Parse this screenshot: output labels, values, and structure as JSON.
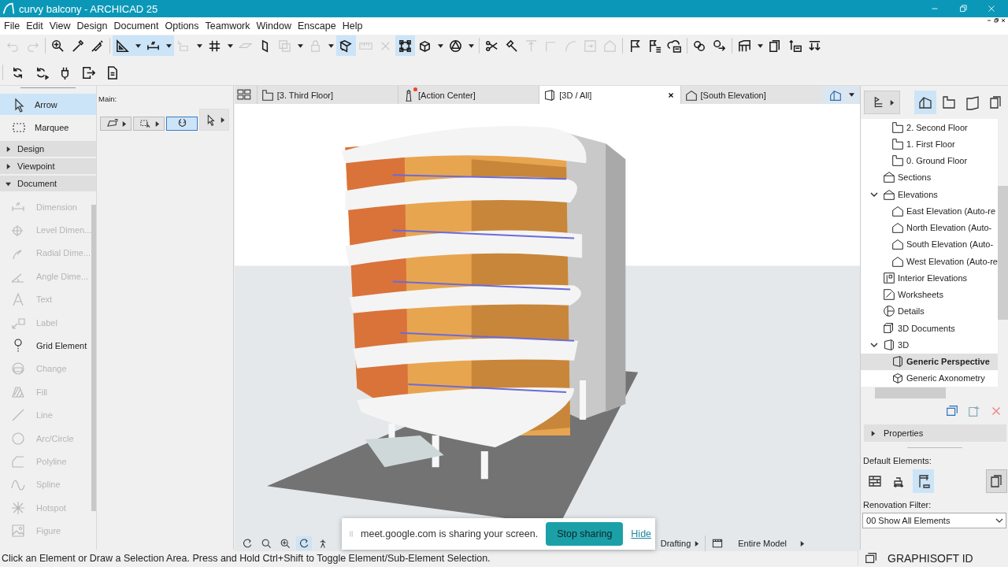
{
  "window": {
    "title": "curvy balcony - ARCHICAD 25"
  },
  "menu": [
    "File",
    "Edit",
    "View",
    "Design",
    "Document",
    "Options",
    "Teamwork",
    "Window",
    "Enscape",
    "Help"
  ],
  "toolbar": [
    {
      "kind": "undo",
      "on": false,
      "disabled": true
    },
    {
      "kind": "redo",
      "on": false,
      "disabled": true
    },
    {
      "kind": "sep"
    },
    {
      "kind": "find",
      "on": false,
      "disabled": false
    },
    {
      "kind": "eyedropper",
      "on": false,
      "disabled": false
    },
    {
      "kind": "syringe",
      "on": false,
      "disabled": false
    },
    {
      "kind": "sep"
    },
    {
      "kind": "setsquare",
      "on": true,
      "disabled": false
    },
    {
      "kind": "caret",
      "on": true
    },
    {
      "kind": "dimension",
      "on": true,
      "disabled": false
    },
    {
      "kind": "caret",
      "on": true
    },
    {
      "kind": "coordinate",
      "on": false,
      "disabled": true
    },
    {
      "kind": "caret",
      "on": false
    },
    {
      "kind": "grid",
      "on": false,
      "disabled": false
    },
    {
      "kind": "caret",
      "on": false
    },
    {
      "kind": "plane",
      "on": false,
      "disabled": true
    },
    {
      "kind": "vplane",
      "on": false,
      "disabled": false
    },
    {
      "kind": "layers",
      "on": false,
      "disabled": true
    },
    {
      "kind": "caret",
      "on": false
    },
    {
      "kind": "lock",
      "on": false,
      "disabled": true
    },
    {
      "kind": "caret",
      "on": false
    },
    {
      "kind": "selcube",
      "on": true,
      "disabled": false
    },
    {
      "kind": "ruler",
      "on": false,
      "disabled": true
    },
    {
      "kind": "cross",
      "on": false,
      "disabled": true
    },
    {
      "kind": "boxsel",
      "on": true,
      "disabled": false
    },
    {
      "kind": "cube",
      "on": false,
      "disabled": false
    },
    {
      "kind": "caret",
      "on": false
    },
    {
      "kind": "tricircle",
      "on": false,
      "disabled": false
    },
    {
      "kind": "caret",
      "on": false
    },
    {
      "kind": "sep"
    },
    {
      "kind": "scissors",
      "on": false,
      "disabled": false
    },
    {
      "kind": "hammer",
      "on": false,
      "disabled": false
    },
    {
      "kind": "aligntop",
      "on": false,
      "disabled": true
    },
    {
      "kind": "corner",
      "on": false,
      "disabled": true
    },
    {
      "kind": "curve",
      "on": false,
      "disabled": true
    },
    {
      "kind": "resize",
      "on": false,
      "disabled": true
    },
    {
      "kind": "house",
      "on": false,
      "disabled": true
    },
    {
      "kind": "sep"
    },
    {
      "kind": "flag",
      "on": false,
      "disabled": false
    },
    {
      "kind": "flaglist",
      "on": false,
      "disabled": false
    },
    {
      "kind": "clouddoc",
      "on": false,
      "disabled": false
    },
    {
      "kind": "sep"
    },
    {
      "kind": "link",
      "on": false,
      "disabled": false
    },
    {
      "kind": "linkarrows",
      "on": false,
      "disabled": false
    },
    {
      "kind": "sep"
    },
    {
      "kind": "stair",
      "on": false,
      "disabled": false
    },
    {
      "kind": "caret",
      "on": false
    },
    {
      "kind": "docstack",
      "on": false,
      "disabled": false
    },
    {
      "kind": "textdoc",
      "on": false,
      "disabled": false
    },
    {
      "kind": "downarrows",
      "on": false,
      "disabled": false
    }
  ],
  "toolbar_2": [
    {
      "kind": "refresh",
      "on": false,
      "disabled": false
    },
    {
      "kind": "refreshplay",
      "on": false,
      "disabled": false
    },
    {
      "kind": "plug",
      "on": false,
      "disabled": false
    },
    {
      "kind": "exit",
      "on": false,
      "disabled": false
    },
    {
      "kind": "doc",
      "on": false,
      "disabled": false
    }
  ],
  "toolbox": {
    "selection": [
      {
        "label": "Arrow",
        "kind": "arrow",
        "selected": true
      },
      {
        "label": "Marquee",
        "kind": "marquee",
        "selected": false
      }
    ],
    "groups": [
      {
        "label": "Design",
        "expanded": false
      },
      {
        "label": "Viewpoint",
        "expanded": false
      },
      {
        "label": "Document",
        "expanded": true
      }
    ],
    "tools": [
      {
        "label": "Dimension",
        "kind": "dimension",
        "disabled": true
      },
      {
        "label": "Level Dimen...",
        "kind": "level",
        "disabled": true
      },
      {
        "label": "Radial Dime...",
        "kind": "radial",
        "disabled": true
      },
      {
        "label": "Angle Dime...",
        "kind": "angle",
        "disabled": true
      },
      {
        "label": "Text",
        "kind": "text",
        "disabled": true
      },
      {
        "label": "Label",
        "kind": "label",
        "disabled": true
      },
      {
        "label": "Grid Element",
        "kind": "gridelement",
        "disabled": false
      },
      {
        "label": "Change",
        "kind": "change",
        "disabled": true
      },
      {
        "label": "Fill",
        "kind": "fill",
        "disabled": true
      },
      {
        "label": "Line",
        "kind": "line",
        "disabled": true
      },
      {
        "label": "Arc/Circle",
        "kind": "arc",
        "disabled": true
      },
      {
        "label": "Polyline",
        "kind": "polyline",
        "disabled": true
      },
      {
        "label": "Spline",
        "kind": "spline",
        "disabled": true
      },
      {
        "label": "Hotspot",
        "kind": "hotspot",
        "disabled": true
      },
      {
        "label": "Figure",
        "kind": "figure",
        "disabled": true
      }
    ]
  },
  "info_box": {
    "label": "Main:",
    "buttons": [
      {
        "kind": "polysel",
        "selected": false
      },
      {
        "kind": "marqsel",
        "selected": false
      },
      {
        "kind": "magnet",
        "selected": true
      },
      {
        "kind": "arrow",
        "selected": false
      }
    ]
  },
  "tabs": [
    {
      "label": "[3. Third Floor]",
      "kind": "floor",
      "selected": false,
      "notification": false
    },
    {
      "label": "[Action Center]",
      "kind": "lighthouse",
      "selected": false,
      "notification": true
    },
    {
      "label": "[3D / All]",
      "kind": "view3d",
      "selected": true,
      "notification": false
    },
    {
      "label": "[South Elevation]",
      "kind": "elevation",
      "selected": false,
      "notification": false
    }
  ],
  "viewport_bar": {
    "items": [
      "Drafting",
      "Entire Model"
    ]
  },
  "share_banner": {
    "message": "meet.google.com is sharing your screen.",
    "stop": "Stop sharing",
    "hide": "Hide"
  },
  "navigator": {
    "modes": [
      {
        "kind": "house3d",
        "selected": true
      },
      {
        "kind": "floor",
        "selected": false
      },
      {
        "kind": "layout",
        "selected": false
      },
      {
        "kind": "docstack",
        "selected": false
      }
    ],
    "tree": [
      {
        "children": [
          {
            "label": "2. Second Floor",
            "kind": "floor",
            "selected": false
          },
          {
            "label": "1. First Floor",
            "kind": "floor",
            "selected": false
          },
          {
            "label": "0. Ground Floor",
            "kind": "floor",
            "selected": false
          }
        ]
      },
      {
        "label": "Sections",
        "kind": "section",
        "selected": false
      },
      {
        "label": "Elevations",
        "kind": "elevationgrp",
        "selected": false,
        "expanded": true,
        "children": [
          {
            "label": "East Elevation (Auto-re",
            "kind": "elevation",
            "selected": false
          },
          {
            "label": "North Elevation (Auto-",
            "kind": "elevation",
            "selected": false
          },
          {
            "label": "South Elevation (Auto-",
            "kind": "elevation",
            "selected": false
          },
          {
            "label": "West Elevation (Auto-re",
            "kind": "elevation",
            "selected": false
          }
        ]
      },
      {
        "label": "Interior Elevations",
        "kind": "interior",
        "selected": false
      },
      {
        "label": "Worksheets",
        "kind": "worksheet",
        "selected": false
      },
      {
        "label": "Details",
        "kind": "detail",
        "selected": false
      },
      {
        "label": "3D Documents",
        "kind": "doc3d",
        "selected": false
      },
      {
        "label": "3D",
        "kind": "view3d",
        "selected": false,
        "expanded": true,
        "children": [
          {
            "label": "Generic Perspective",
            "kind": "view3d",
            "selected": true
          },
          {
            "label": "Generic Axonometry",
            "kind": "cube",
            "selected": false
          }
        ]
      }
    ]
  },
  "properties": {
    "label": "Properties",
    "expanded": false
  },
  "default_elements": {
    "label": "Default Elements:",
    "buttons": [
      {
        "kind": "wall",
        "selected": false
      },
      {
        "kind": "machine",
        "selected": false
      },
      {
        "kind": "crane",
        "selected": true
      }
    ]
  },
  "renovation_filter": {
    "label": "Renovation Filter:",
    "value": "00 Show All Elements"
  },
  "graphisoft_id": "GRAPHISOFT ID",
  "status_bar": "Click an Element or Draw a Selection Area. Press and Hold Ctrl+Shift to Toggle Element/Sub-Element Selection."
}
